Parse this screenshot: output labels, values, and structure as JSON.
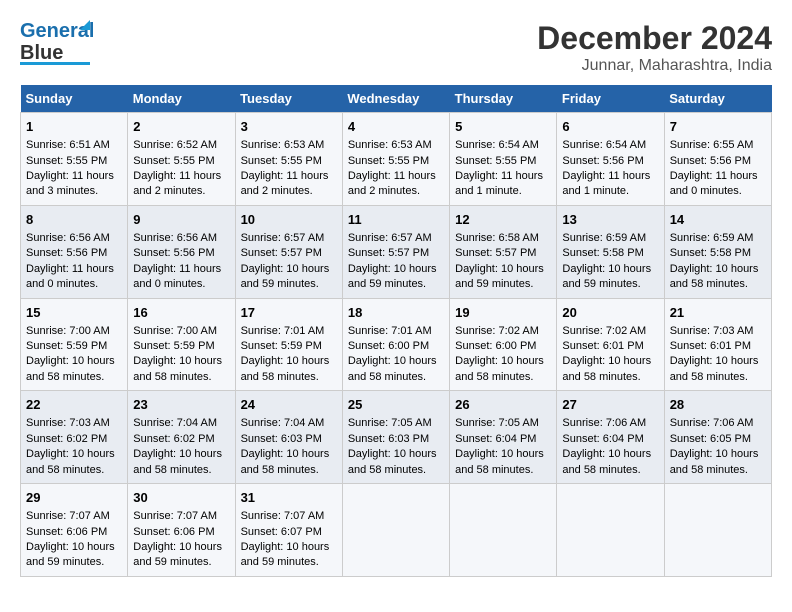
{
  "logo": {
    "text1": "General",
    "text2": "Blue"
  },
  "title": "December 2024",
  "subtitle": "Junnar, Maharashtra, India",
  "columns": [
    "Sunday",
    "Monday",
    "Tuesday",
    "Wednesday",
    "Thursday",
    "Friday",
    "Saturday"
  ],
  "weeks": [
    [
      {
        "day": "1",
        "sunrise": "Sunrise: 6:51 AM",
        "sunset": "Sunset: 5:55 PM",
        "daylight": "Daylight: 11 hours and 3 minutes."
      },
      {
        "day": "2",
        "sunrise": "Sunrise: 6:52 AM",
        "sunset": "Sunset: 5:55 PM",
        "daylight": "Daylight: 11 hours and 2 minutes."
      },
      {
        "day": "3",
        "sunrise": "Sunrise: 6:53 AM",
        "sunset": "Sunset: 5:55 PM",
        "daylight": "Daylight: 11 hours and 2 minutes."
      },
      {
        "day": "4",
        "sunrise": "Sunrise: 6:53 AM",
        "sunset": "Sunset: 5:55 PM",
        "daylight": "Daylight: 11 hours and 2 minutes."
      },
      {
        "day": "5",
        "sunrise": "Sunrise: 6:54 AM",
        "sunset": "Sunset: 5:55 PM",
        "daylight": "Daylight: 11 hours and 1 minute."
      },
      {
        "day": "6",
        "sunrise": "Sunrise: 6:54 AM",
        "sunset": "Sunset: 5:56 PM",
        "daylight": "Daylight: 11 hours and 1 minute."
      },
      {
        "day": "7",
        "sunrise": "Sunrise: 6:55 AM",
        "sunset": "Sunset: 5:56 PM",
        "daylight": "Daylight: 11 hours and 0 minutes."
      }
    ],
    [
      {
        "day": "8",
        "sunrise": "Sunrise: 6:56 AM",
        "sunset": "Sunset: 5:56 PM",
        "daylight": "Daylight: 11 hours and 0 minutes."
      },
      {
        "day": "9",
        "sunrise": "Sunrise: 6:56 AM",
        "sunset": "Sunset: 5:56 PM",
        "daylight": "Daylight: 11 hours and 0 minutes."
      },
      {
        "day": "10",
        "sunrise": "Sunrise: 6:57 AM",
        "sunset": "Sunset: 5:57 PM",
        "daylight": "Daylight: 10 hours and 59 minutes."
      },
      {
        "day": "11",
        "sunrise": "Sunrise: 6:57 AM",
        "sunset": "Sunset: 5:57 PM",
        "daylight": "Daylight: 10 hours and 59 minutes."
      },
      {
        "day": "12",
        "sunrise": "Sunrise: 6:58 AM",
        "sunset": "Sunset: 5:57 PM",
        "daylight": "Daylight: 10 hours and 59 minutes."
      },
      {
        "day": "13",
        "sunrise": "Sunrise: 6:59 AM",
        "sunset": "Sunset: 5:58 PM",
        "daylight": "Daylight: 10 hours and 59 minutes."
      },
      {
        "day": "14",
        "sunrise": "Sunrise: 6:59 AM",
        "sunset": "Sunset: 5:58 PM",
        "daylight": "Daylight: 10 hours and 58 minutes."
      }
    ],
    [
      {
        "day": "15",
        "sunrise": "Sunrise: 7:00 AM",
        "sunset": "Sunset: 5:59 PM",
        "daylight": "Daylight: 10 hours and 58 minutes."
      },
      {
        "day": "16",
        "sunrise": "Sunrise: 7:00 AM",
        "sunset": "Sunset: 5:59 PM",
        "daylight": "Daylight: 10 hours and 58 minutes."
      },
      {
        "day": "17",
        "sunrise": "Sunrise: 7:01 AM",
        "sunset": "Sunset: 5:59 PM",
        "daylight": "Daylight: 10 hours and 58 minutes."
      },
      {
        "day": "18",
        "sunrise": "Sunrise: 7:01 AM",
        "sunset": "Sunset: 6:00 PM",
        "daylight": "Daylight: 10 hours and 58 minutes."
      },
      {
        "day": "19",
        "sunrise": "Sunrise: 7:02 AM",
        "sunset": "Sunset: 6:00 PM",
        "daylight": "Daylight: 10 hours and 58 minutes."
      },
      {
        "day": "20",
        "sunrise": "Sunrise: 7:02 AM",
        "sunset": "Sunset: 6:01 PM",
        "daylight": "Daylight: 10 hours and 58 minutes."
      },
      {
        "day": "21",
        "sunrise": "Sunrise: 7:03 AM",
        "sunset": "Sunset: 6:01 PM",
        "daylight": "Daylight: 10 hours and 58 minutes."
      }
    ],
    [
      {
        "day": "22",
        "sunrise": "Sunrise: 7:03 AM",
        "sunset": "Sunset: 6:02 PM",
        "daylight": "Daylight: 10 hours and 58 minutes."
      },
      {
        "day": "23",
        "sunrise": "Sunrise: 7:04 AM",
        "sunset": "Sunset: 6:02 PM",
        "daylight": "Daylight: 10 hours and 58 minutes."
      },
      {
        "day": "24",
        "sunrise": "Sunrise: 7:04 AM",
        "sunset": "Sunset: 6:03 PM",
        "daylight": "Daylight: 10 hours and 58 minutes."
      },
      {
        "day": "25",
        "sunrise": "Sunrise: 7:05 AM",
        "sunset": "Sunset: 6:03 PM",
        "daylight": "Daylight: 10 hours and 58 minutes."
      },
      {
        "day": "26",
        "sunrise": "Sunrise: 7:05 AM",
        "sunset": "Sunset: 6:04 PM",
        "daylight": "Daylight: 10 hours and 58 minutes."
      },
      {
        "day": "27",
        "sunrise": "Sunrise: 7:06 AM",
        "sunset": "Sunset: 6:04 PM",
        "daylight": "Daylight: 10 hours and 58 minutes."
      },
      {
        "day": "28",
        "sunrise": "Sunrise: 7:06 AM",
        "sunset": "Sunset: 6:05 PM",
        "daylight": "Daylight: 10 hours and 58 minutes."
      }
    ],
    [
      {
        "day": "29",
        "sunrise": "Sunrise: 7:07 AM",
        "sunset": "Sunset: 6:06 PM",
        "daylight": "Daylight: 10 hours and 59 minutes."
      },
      {
        "day": "30",
        "sunrise": "Sunrise: 7:07 AM",
        "sunset": "Sunset: 6:06 PM",
        "daylight": "Daylight: 10 hours and 59 minutes."
      },
      {
        "day": "31",
        "sunrise": "Sunrise: 7:07 AM",
        "sunset": "Sunset: 6:07 PM",
        "daylight": "Daylight: 10 hours and 59 minutes."
      },
      {
        "day": "",
        "sunrise": "",
        "sunset": "",
        "daylight": ""
      },
      {
        "day": "",
        "sunrise": "",
        "sunset": "",
        "daylight": ""
      },
      {
        "day": "",
        "sunrise": "",
        "sunset": "",
        "daylight": ""
      },
      {
        "day": "",
        "sunrise": "",
        "sunset": "",
        "daylight": ""
      }
    ]
  ]
}
